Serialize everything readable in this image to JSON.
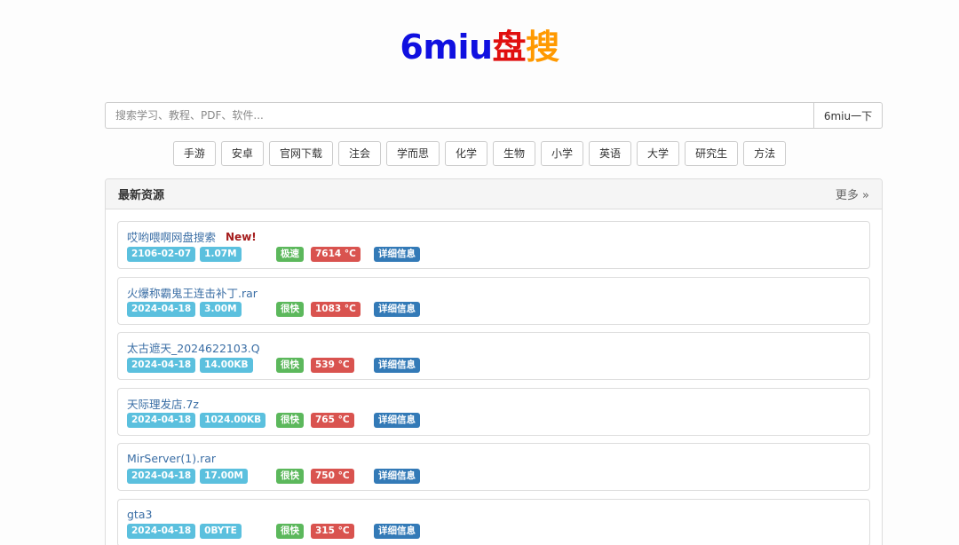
{
  "logo": {
    "parts": [
      {
        "text": "6miu",
        "color": "#1010e0"
      },
      {
        "text": "盘",
        "color": "#e01010"
      },
      {
        "text": "搜",
        "color": "#ff9900"
      }
    ]
  },
  "search": {
    "placeholder": "搜索学习、教程、PDF、软件...",
    "value": "",
    "button": "6miu一下"
  },
  "tags": [
    "手游",
    "安卓",
    "官网下载",
    "注会",
    "学而思",
    "化学",
    "生物",
    "小学",
    "英语",
    "大学",
    "研究生",
    "方法"
  ],
  "panel": {
    "title": "最新资源",
    "more": "更多 »",
    "detail_label": "详细信息",
    "new_label": "New!",
    "items": [
      {
        "name": "哎哟喂啊网盘搜索",
        "is_new": true,
        "date": "2106-02-07",
        "size": "1.07M",
        "speed": "极速",
        "heat": "7614 °C"
      },
      {
        "name": "火爆称霸鬼王连击补丁.rar",
        "is_new": false,
        "date": "2024-04-18",
        "size": "3.00M",
        "speed": "很快",
        "heat": "1083 °C"
      },
      {
        "name": "太古遮天_2024622103.Q",
        "is_new": false,
        "date": "2024-04-18",
        "size": "14.00KB",
        "speed": "很快",
        "heat": "539 °C"
      },
      {
        "name": "天际理发店.7z",
        "is_new": false,
        "date": "2024-04-18",
        "size": "1024.00KB",
        "speed": "很快",
        "heat": "765 °C"
      },
      {
        "name": "MirServer(1).rar",
        "is_new": false,
        "date": "2024-04-18",
        "size": "17.00M",
        "speed": "很快",
        "heat": "750 °C"
      },
      {
        "name": "gta3",
        "is_new": false,
        "date": "2024-04-18",
        "size": "0BYTE",
        "speed": "很快",
        "heat": "315 °C"
      }
    ]
  }
}
